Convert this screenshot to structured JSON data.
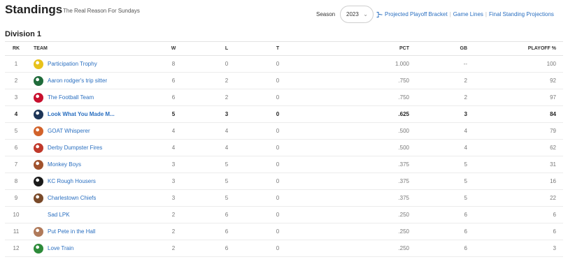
{
  "header": {
    "title": "Standings",
    "subtitle": "The Real Reason For Sundays"
  },
  "season": {
    "label": "Season",
    "value": "2023"
  },
  "links": {
    "bracket": "Projected Playoff Bracket",
    "game_lines": "Game Lines",
    "final_projections": "Final Standing Projections"
  },
  "division": {
    "name": "Division 1"
  },
  "columns": {
    "rk": "RK",
    "team": "TEAM",
    "w": "W",
    "l": "L",
    "t": "T",
    "pct": "PCT",
    "gb": "GB",
    "playoff": "PLAYOFF %"
  },
  "accent_color": "#2a6fc0",
  "rows": [
    {
      "rk": "1",
      "team": "Participation Trophy",
      "logo": "trophy-logo",
      "logo_color": "#e8c21c",
      "w": "8",
      "l": "0",
      "t": "0",
      "pct": "1.000",
      "gb": "--",
      "playoff": "100"
    },
    {
      "rk": "2",
      "team": "Aaron rodger's trip sitter",
      "logo": "jets-logo",
      "logo_color": "#1f6b3a",
      "w": "6",
      "l": "2",
      "t": "0",
      "pct": ".750",
      "gb": "2",
      "playoff": "92"
    },
    {
      "rk": "3",
      "team": "The Football Team",
      "logo": "patriots-logo",
      "logo_color": "#c8102e",
      "w": "6",
      "l": "2",
      "t": "0",
      "pct": ".750",
      "gb": "2",
      "playoff": "97"
    },
    {
      "rk": "4",
      "team": "Look What You Made M...",
      "logo": "dark-logo",
      "logo_color": "#1d3557",
      "w": "5",
      "l": "3",
      "t": "0",
      "pct": ".625",
      "gb": "3",
      "playoff": "84",
      "highlight": true
    },
    {
      "rk": "5",
      "team": "GOAT Whisperer",
      "logo": "goat-logo",
      "logo_color": "#d2622a",
      "w": "4",
      "l": "4",
      "t": "0",
      "pct": ".500",
      "gb": "4",
      "playoff": "79"
    },
    {
      "rk": "6",
      "team": "Derby Dumpster Fires",
      "logo": "fire-logo",
      "logo_color": "#c0392b",
      "w": "4",
      "l": "4",
      "t": "0",
      "pct": ".500",
      "gb": "4",
      "playoff": "62"
    },
    {
      "rk": "7",
      "team": "Monkey Boys",
      "logo": "monkey-logo",
      "logo_color": "#a0522d",
      "w": "3",
      "l": "5",
      "t": "0",
      "pct": ".375",
      "gb": "5",
      "playoff": "31"
    },
    {
      "rk": "8",
      "team": "KC Rough Housers",
      "logo": "kc-logo",
      "logo_color": "#1a1a1a",
      "w": "3",
      "l": "5",
      "t": "0",
      "pct": ".375",
      "gb": "5",
      "playoff": "16"
    },
    {
      "rk": "9",
      "team": "Charlestown Chiefs",
      "logo": "chiefs-logo",
      "logo_color": "#7a4a2a",
      "w": "3",
      "l": "5",
      "t": "0",
      "pct": ".375",
      "gb": "5",
      "playoff": "22"
    },
    {
      "rk": "10",
      "team": "Sad LPK",
      "logo": "",
      "logo_color": "",
      "w": "2",
      "l": "6",
      "t": "0",
      "pct": ".250",
      "gb": "6",
      "playoff": "6"
    },
    {
      "rk": "11",
      "team": "Put Pete in the Hall",
      "logo": "pete-logo",
      "logo_color": "#b07a5a",
      "w": "2",
      "l": "6",
      "t": "0",
      "pct": ".250",
      "gb": "6",
      "playoff": "6"
    },
    {
      "rk": "12",
      "team": "Love Train",
      "logo": "gator-logo",
      "logo_color": "#2e8b3a",
      "w": "2",
      "l": "6",
      "t": "0",
      "pct": ".250",
      "gb": "6",
      "playoff": "3"
    }
  ]
}
